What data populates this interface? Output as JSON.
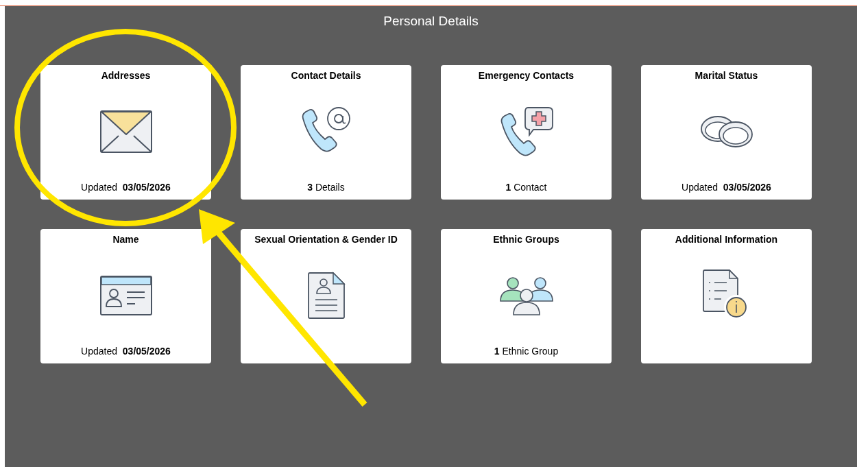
{
  "page": {
    "title": "Personal Details"
  },
  "tiles": [
    {
      "title": "Addresses",
      "footer": "Updated  **03/05/2026**",
      "highlighted": true
    },
    {
      "title": "Contact Details",
      "footer": "**3** Details",
      "highlighted": false
    },
    {
      "title": "Emergency Contacts",
      "footer": "**1** Contact",
      "highlighted": false
    },
    {
      "title": "Marital Status",
      "footer": "Updated  **03/05/2026**",
      "highlighted": false
    },
    {
      "title": "Name",
      "footer": "Updated  **03/05/2026**",
      "highlighted": false
    },
    {
      "title": "Sexual Orientation & Gender ID",
      "highlighted": false
    },
    {
      "title": "Ethnic Groups",
      "footer": "**1** Ethnic Group",
      "highlighted": false
    },
    {
      "title": "Additional Information",
      "highlighted": false
    }
  ]
}
